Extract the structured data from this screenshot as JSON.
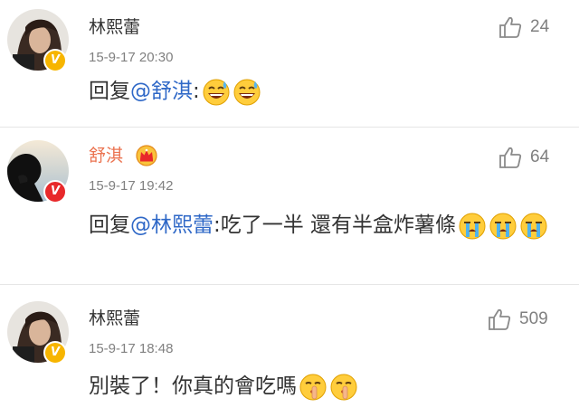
{
  "comments": [
    {
      "username": "林熙蕾",
      "timestamp": "15-9-17 20:30",
      "reply_prefix": "回复",
      "mention": "@舒淇",
      "separator": ":",
      "text": "",
      "emojis": [
        "sweat-smile-emoji",
        "sweat-smile-emoji"
      ],
      "likes": "24",
      "badge": "V",
      "badge_color": "#f7b500"
    },
    {
      "username": "舒淇",
      "timestamp": "15-9-17 19:42",
      "reply_prefix": "回复",
      "mention": "@林熙蕾",
      "separator": ":",
      "text": "吃了一半 還有半盒炸薯條",
      "emojis": [
        "crying-emoji",
        "crying-emoji",
        "crying-emoji"
      ],
      "likes": "64",
      "badge": "V",
      "badge_color": "#e8292b",
      "vip_icon": "crown-icon"
    },
    {
      "username": "林熙蕾",
      "timestamp": "15-9-17 18:48",
      "text": "別裝了！你真的會吃嗎",
      "emojis": [
        "shush-emoji",
        "shush-emoji"
      ],
      "likes": "509",
      "badge": "V",
      "badge_color": "#f7b500"
    }
  ],
  "colors": {
    "mention": "#2f68c7",
    "username_vip": "#eb7350",
    "timestamp": "#808080",
    "text": "#333333"
  }
}
